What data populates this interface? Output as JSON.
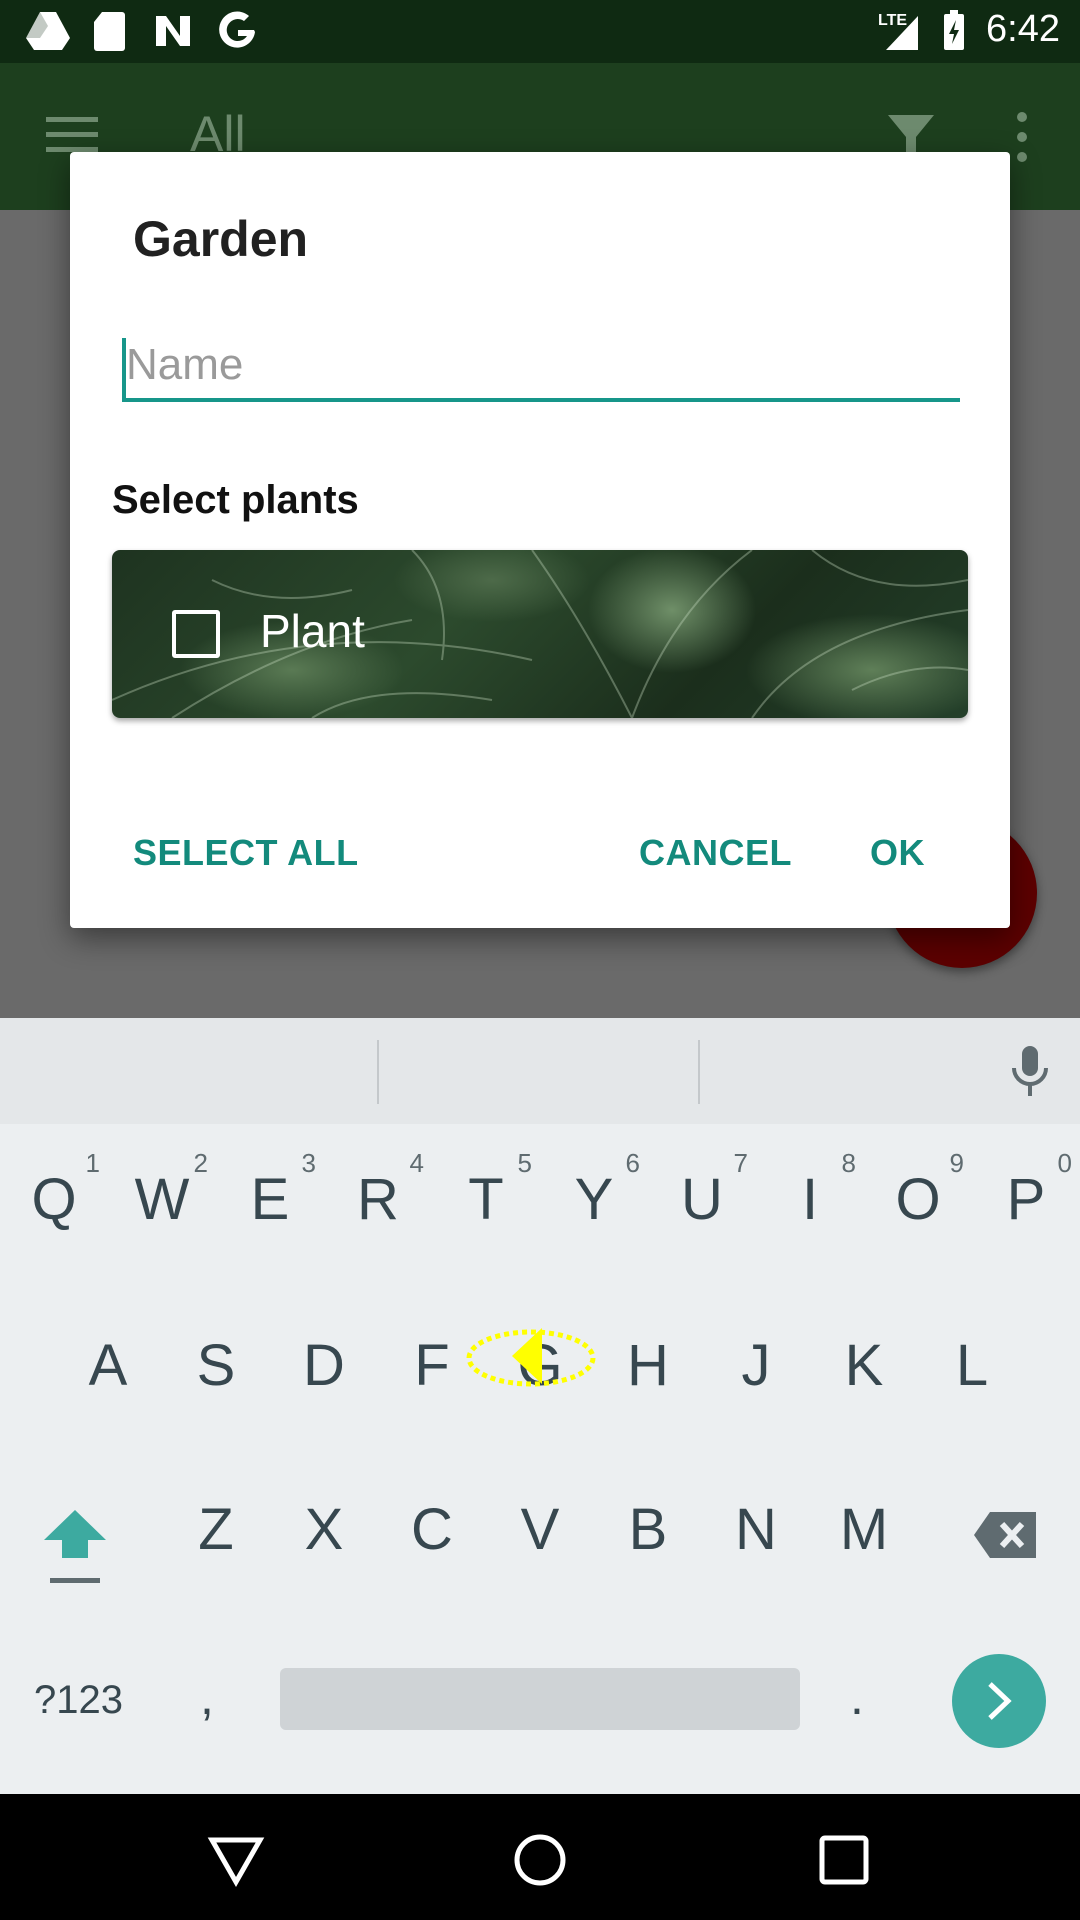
{
  "status_bar": {
    "time": "6:42",
    "network": "LTE"
  },
  "app_bar": {
    "title": "All"
  },
  "dialog": {
    "title": "Garden",
    "name_placeholder": "Name",
    "name_value": "",
    "section_label": "Select plants",
    "plants": [
      {
        "label": "Plant",
        "checked": false
      }
    ],
    "buttons": {
      "select_all": "SELECT ALL",
      "cancel": "CANCEL",
      "ok": "OK"
    }
  },
  "keyboard": {
    "row1": [
      {
        "key": "Q",
        "hint": "1"
      },
      {
        "key": "W",
        "hint": "2"
      },
      {
        "key": "E",
        "hint": "3"
      },
      {
        "key": "R",
        "hint": "4"
      },
      {
        "key": "T",
        "hint": "5"
      },
      {
        "key": "Y",
        "hint": "6"
      },
      {
        "key": "U",
        "hint": "7"
      },
      {
        "key": "I",
        "hint": "8"
      },
      {
        "key": "O",
        "hint": "9"
      },
      {
        "key": "P",
        "hint": "0"
      }
    ],
    "row2": [
      "A",
      "S",
      "D",
      "F",
      "G",
      "H",
      "J",
      "K",
      "L"
    ],
    "row3": [
      "Z",
      "X",
      "C",
      "V",
      "B",
      "N",
      "M"
    ],
    "symbols_label": "?123",
    "comma": ",",
    "period": "."
  },
  "colors": {
    "accent": "#17968a",
    "app_bar": "#1d3f1e",
    "fab": "#5c0000"
  }
}
